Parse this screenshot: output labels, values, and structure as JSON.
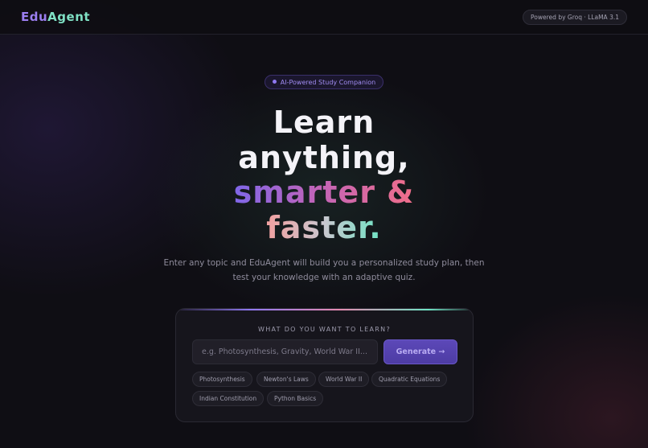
{
  "header": {
    "logo_part1": "Edu",
    "logo_part2": "Agent",
    "powered_by": "Powered by Groq · LLaMA 3.1"
  },
  "hero": {
    "badge": "AI-Powered Study Companion",
    "line1": "Learn",
    "line2": "anything,",
    "line3": "smarter &",
    "line4": "faster.",
    "subtitle": "Enter any topic and EduAgent will build you a personalized study plan, then test your knowledge with an adaptive quiz."
  },
  "form": {
    "label": "WHAT DO YOU WANT TO LEARN?",
    "placeholder": "e.g. Photosynthesis, Gravity, World War II...",
    "value": "",
    "button_label": "Generate →",
    "suggestions": [
      "Photosynthesis",
      "Newton's Laws",
      "World War II",
      "Quadratic Equations",
      "Indian Constitution",
      "Python Basics"
    ]
  },
  "colors": {
    "accent_purple": "#8f78f0",
    "accent_pink": "#f06e8a",
    "accent_mint": "#6fe3c4",
    "background": "#0f0e14"
  }
}
